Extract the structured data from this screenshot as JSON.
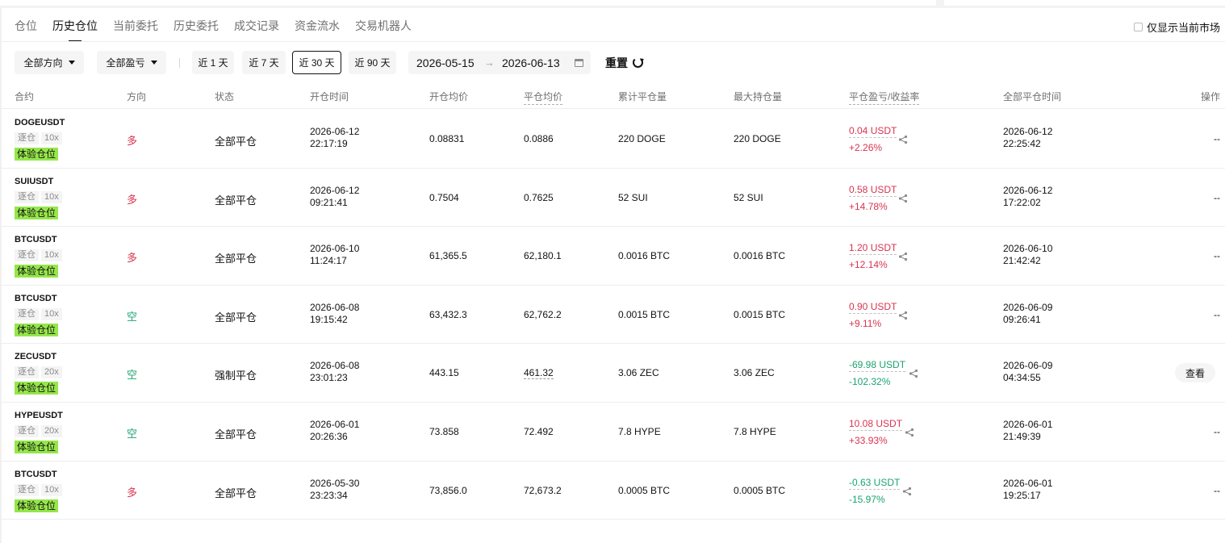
{
  "tabs": [
    "仓位",
    "历史仓位",
    "当前委托",
    "历史委托",
    "成交记录",
    "资金流水",
    "交易机器人"
  ],
  "only_current_market": "仅显示当前市场",
  "filters": {
    "direction": "全部方向",
    "pnl": "全部盈亏",
    "ranges": [
      "近 1 天",
      "近 7 天",
      "近 30 天",
      "近 90 天"
    ],
    "selected_range": "近 30 天",
    "date_from": "2026-05-15",
    "date_arrow": "→",
    "date_to": "2026-06-13",
    "reset": "重置"
  },
  "columns": {
    "symbol": "合约",
    "direction": "方向",
    "status": "状态",
    "open_time": "开仓时间",
    "open_avg": "开仓均价",
    "close_avg": "平仓均价",
    "cum_close": "累计平仓量",
    "max_pos": "最大持仓量",
    "pnl": "平仓盈亏/收益率",
    "close_time": "全部平仓时间",
    "action": "操作"
  },
  "colors": {
    "long": "#d9334f",
    "short": "#1aa36f",
    "trial_tag": "#95e64a"
  },
  "rows": [
    {
      "symbol": "DOGEUSDT",
      "margin": "逐仓",
      "leverage": "10x",
      "trial": "体验仓位",
      "direction": "多",
      "side": "long",
      "status": "全部平仓",
      "open_date": "2026-06-12",
      "open_clock": "22:17:19",
      "open_avg": "0.08831",
      "close_avg": "0.0886",
      "cum": "220 DOGE",
      "max": "220 DOGE",
      "pnl": "0.04 USDT",
      "rate": "+2.26%",
      "close_date": "2026-06-12",
      "close_clock": "22:25:42",
      "action": "--"
    },
    {
      "symbol": "SUIUSDT",
      "margin": "逐仓",
      "leverage": "10x",
      "trial": "体验仓位",
      "direction": "多",
      "side": "long",
      "status": "全部平仓",
      "open_date": "2026-06-12",
      "open_clock": "09:21:41",
      "open_avg": "0.7504",
      "close_avg": "0.7625",
      "cum": "52 SUI",
      "max": "52 SUI",
      "pnl": "0.58 USDT",
      "rate": "+14.78%",
      "close_date": "2026-06-12",
      "close_clock": "17:22:02",
      "action": "--"
    },
    {
      "symbol": "BTCUSDT",
      "margin": "逐仓",
      "leverage": "10x",
      "trial": "体验仓位",
      "direction": "多",
      "side": "long",
      "status": "全部平仓",
      "open_date": "2026-06-10",
      "open_clock": "11:24:17",
      "open_avg": "61,365.5",
      "close_avg": "62,180.1",
      "cum": "0.0016 BTC",
      "max": "0.0016 BTC",
      "pnl": "1.20 USDT",
      "rate": "+12.14%",
      "close_date": "2026-06-10",
      "close_clock": "21:42:42",
      "action": "--"
    },
    {
      "symbol": "BTCUSDT",
      "margin": "逐仓",
      "leverage": "10x",
      "trial": "体验仓位",
      "direction": "空",
      "side": "short",
      "status": "全部平仓",
      "open_date": "2026-06-08",
      "open_clock": "19:15:42",
      "open_avg": "63,432.3",
      "close_avg": "62,762.2",
      "cum": "0.0015 BTC",
      "max": "0.0015 BTC",
      "pnl": "0.90 USDT",
      "rate": "+9.11%",
      "close_date": "2026-06-09",
      "close_clock": "09:26:41",
      "action": "--"
    },
    {
      "symbol": "ZECUSDT",
      "margin": "逐仓",
      "leverage": "20x",
      "trial": "体验仓位",
      "direction": "空",
      "side": "short",
      "status": "强制平仓",
      "open_date": "2026-06-08",
      "open_clock": "23:01:23",
      "open_avg": "443.15",
      "close_avg": "461.32",
      "cum": "3.06 ZEC",
      "max": "3.06 ZEC",
      "pnl": "-69.98 USDT",
      "rate": "-102.32%",
      "close_date": "2026-06-09",
      "close_clock": "04:34:55",
      "action": "查看"
    },
    {
      "symbol": "HYPEUSDT",
      "margin": "逐仓",
      "leverage": "20x",
      "trial": "体验仓位",
      "direction": "空",
      "side": "short",
      "status": "全部平仓",
      "open_date": "2026-06-01",
      "open_clock": "20:26:36",
      "open_avg": "73.858",
      "close_avg": "72.492",
      "cum": "7.8 HYPE",
      "max": "7.8 HYPE",
      "pnl": "10.08 USDT",
      "rate": "+33.93%",
      "close_date": "2026-06-01",
      "close_clock": "21:49:39",
      "action": "--"
    },
    {
      "symbol": "BTCUSDT",
      "margin": "逐仓",
      "leverage": "10x",
      "trial": "体验仓位",
      "direction": "多",
      "side": "long",
      "status": "全部平仓",
      "open_date": "2026-05-30",
      "open_clock": "23:23:34",
      "open_avg": "73,856.0",
      "close_avg": "72,673.2",
      "cum": "0.0005 BTC",
      "max": "0.0005 BTC",
      "pnl": "-0.63 USDT",
      "rate": "-15.97%",
      "close_date": "2026-06-01",
      "close_clock": "19:25:17",
      "action": "--"
    }
  ]
}
